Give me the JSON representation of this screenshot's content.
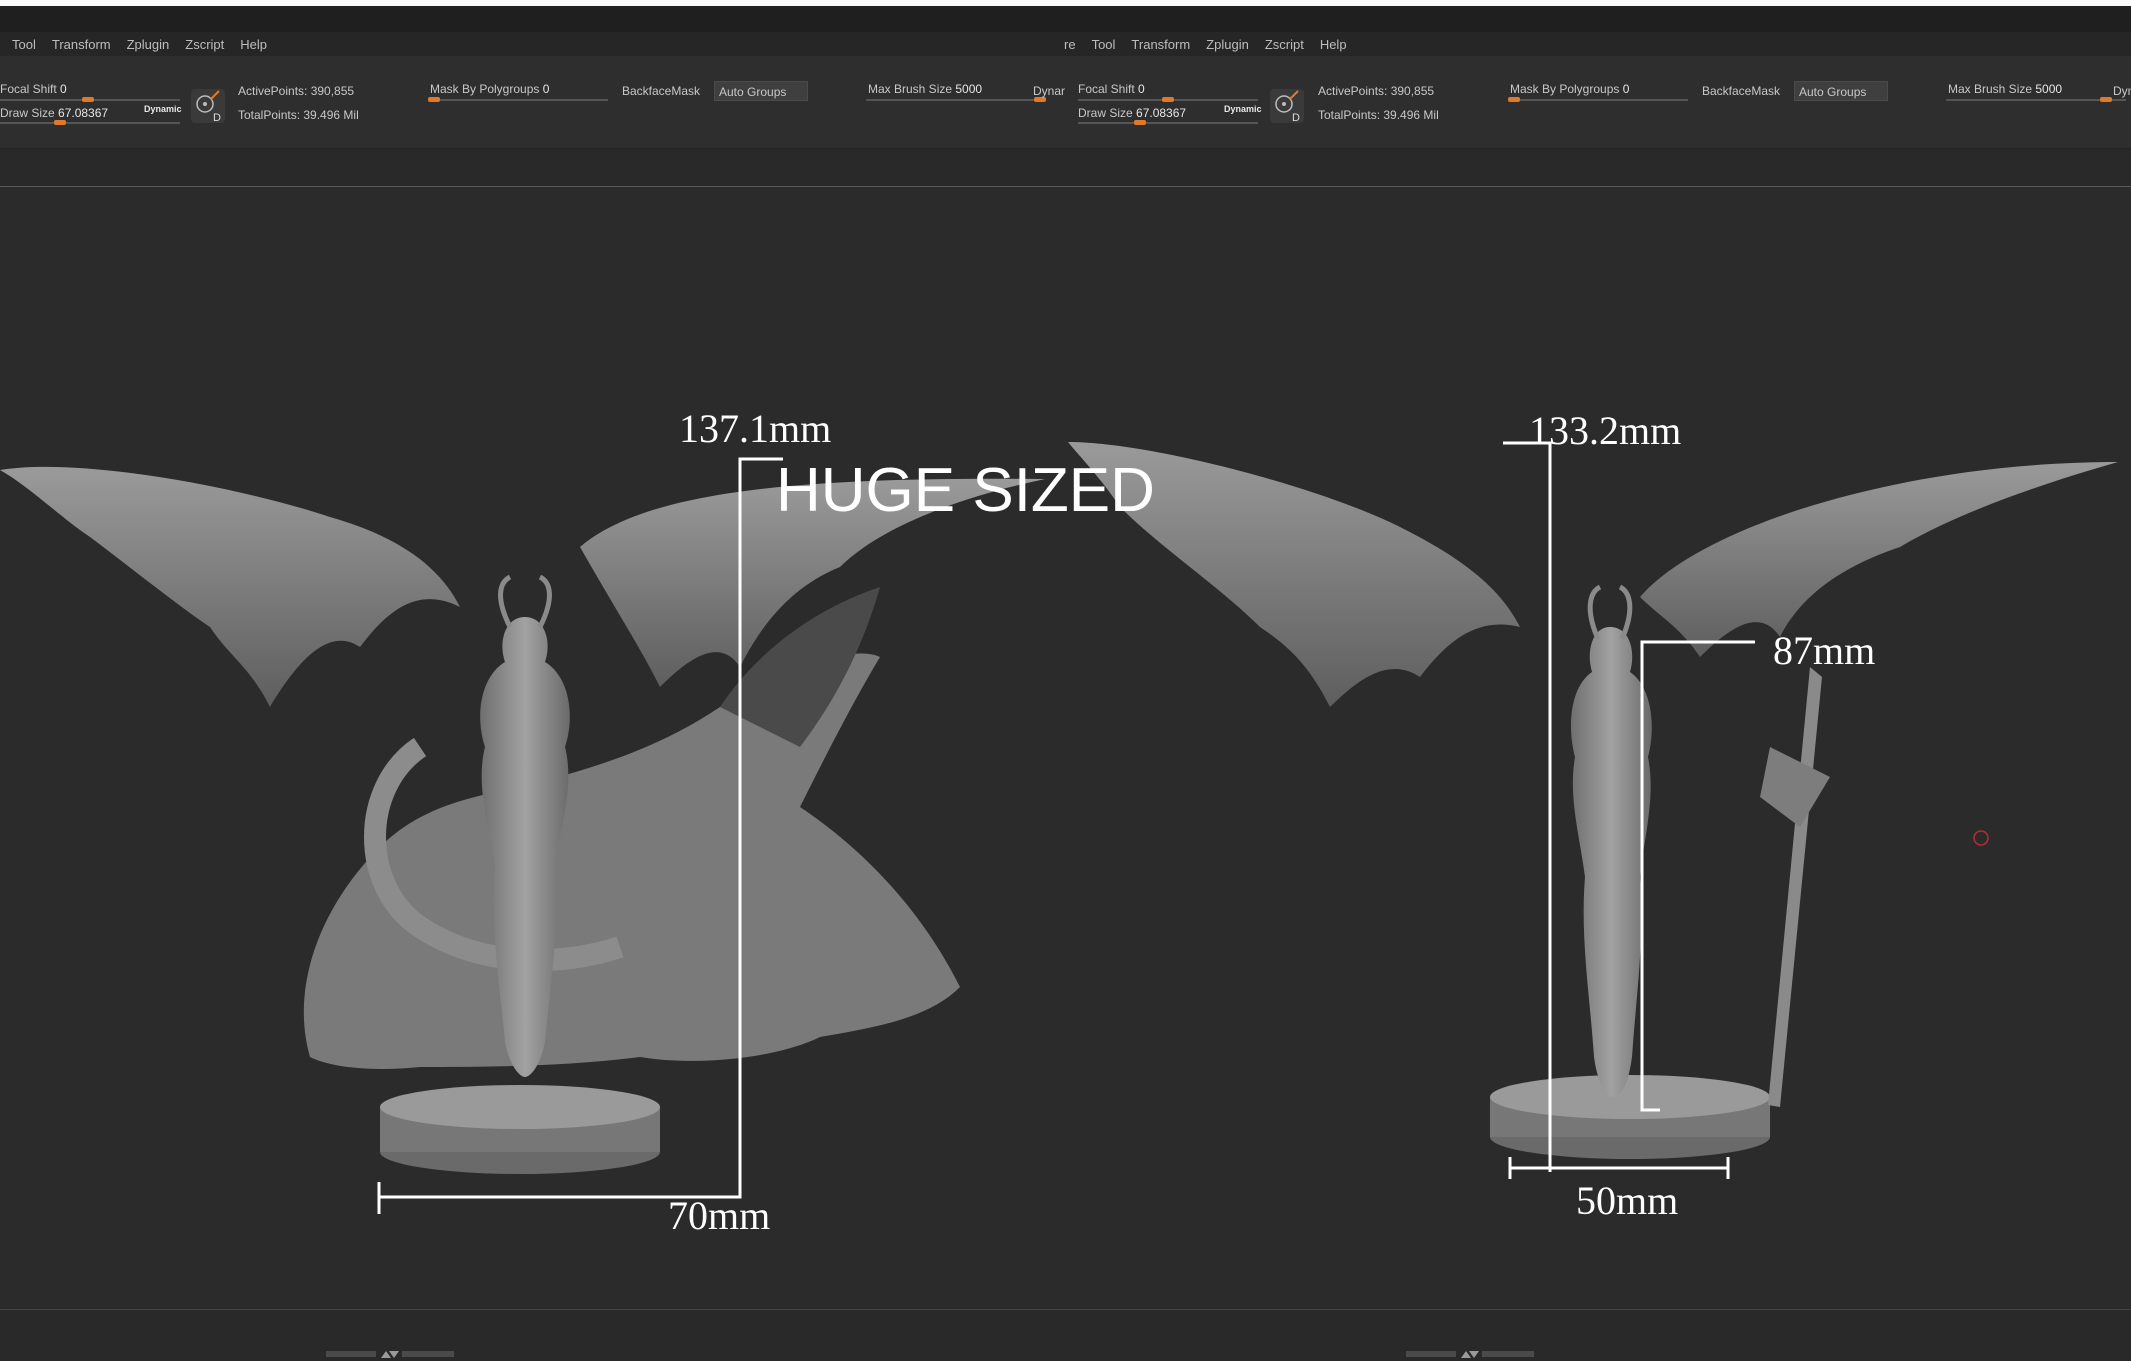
{
  "menus": {
    "left": [
      "Tool",
      "Transform",
      "Zplugin",
      "Zscript",
      "Help"
    ],
    "right": [
      "re",
      "Tool",
      "Transform",
      "Zplugin",
      "Zscript",
      "Help"
    ]
  },
  "toolbar": {
    "focal_shift_label": "Focal Shift",
    "focal_shift_value": "0",
    "draw_size_label": "Draw Size",
    "draw_size_value": "67.08367",
    "dynamic_label": "Dynamic",
    "active_points": "ActivePoints: 390,855",
    "total_points": "TotalPoints: 39.496 Mil",
    "mask_by_polygroups_label": "Mask By Polygroups",
    "mask_by_polygroups_value": "0",
    "backface_mask_label": "BackfaceMask",
    "auto_groups_label": "Auto Groups",
    "max_brush_size_label": "Max Brush Size",
    "max_brush_size_value": "5000",
    "dynamic_cut_left": "Dynar",
    "dynamic_cut_right": "Dyn",
    "d_icon_letter": "D"
  },
  "canvas": {
    "title": "HUGE SIZED",
    "left_model": {
      "height_label": "137.1mm",
      "base_label": "70mm"
    },
    "right_model": {
      "height_label": "133.2mm",
      "figure_label": "87mm",
      "base_label": "50mm"
    }
  },
  "colors": {
    "accent_orange": "#e0792b",
    "ui_background": "#2b2b2b",
    "annotation": "#ffffff",
    "model_grey": "#8a8a8a"
  }
}
